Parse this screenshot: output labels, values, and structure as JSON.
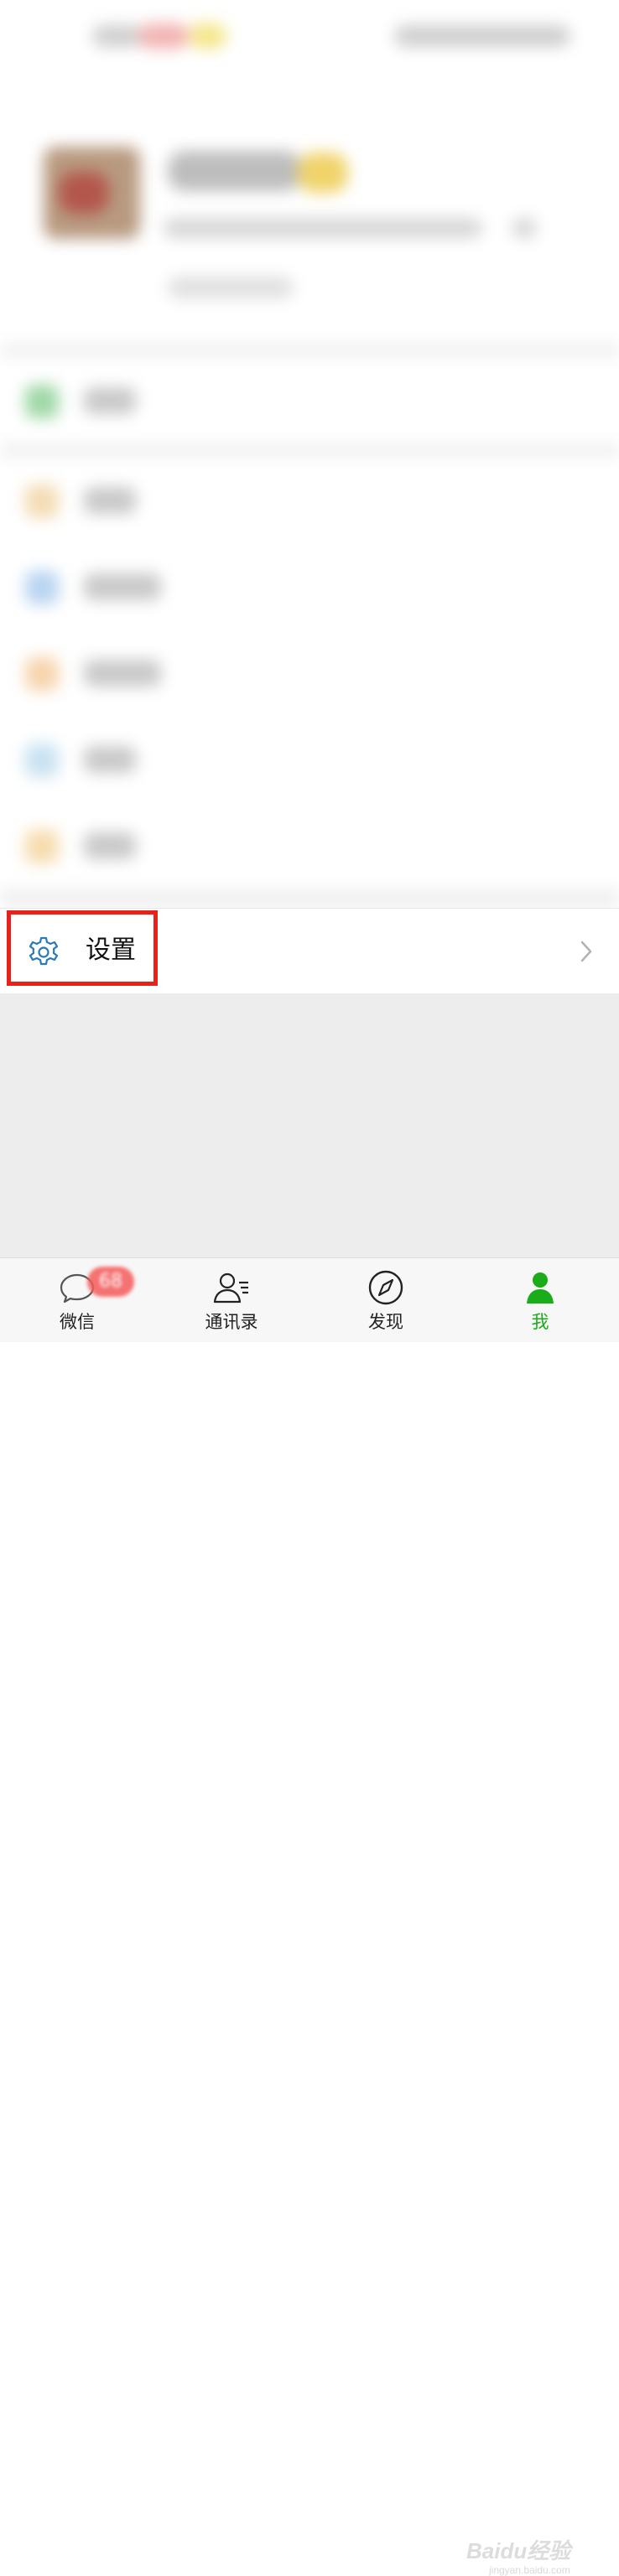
{
  "settings": {
    "label": "设置"
  },
  "tabbar": {
    "tabs": [
      {
        "label": "微信",
        "badge": "68",
        "icon": "chat-bubble-icon"
      },
      {
        "label": "通讯录",
        "icon": "contacts-icon"
      },
      {
        "label": "发现",
        "icon": "compass-icon"
      },
      {
        "label": "我",
        "icon": "person-icon"
      }
    ]
  },
  "watermark": {
    "brand": "Baidu经验",
    "url": "jingyan.baidu.com"
  },
  "colors": {
    "highlight": "#e8211b",
    "active_tab": "#1aad19",
    "gear_icon": "#2a7ab8",
    "badge": "#f55b5b"
  }
}
